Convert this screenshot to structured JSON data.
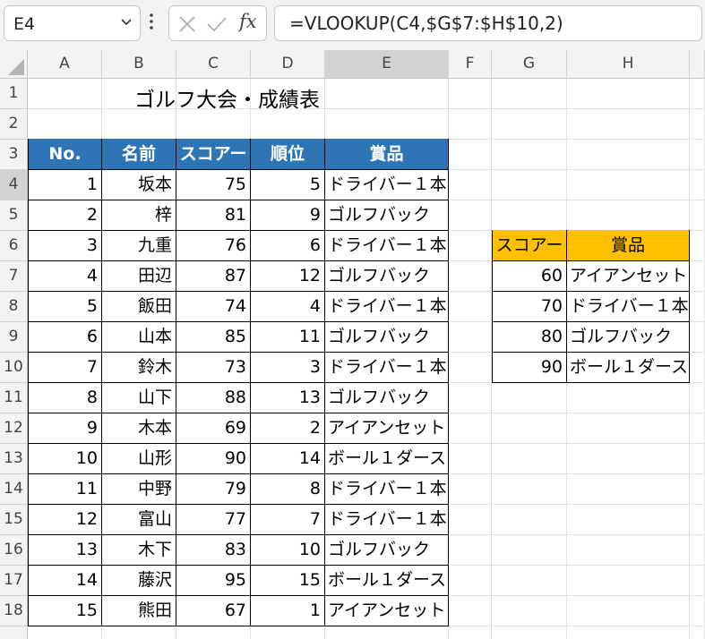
{
  "name_box": "E4",
  "formula_bar": {
    "fx_label": "fx",
    "formula": "=VLOOKUP(C4,$G$7:$H$10,2)"
  },
  "columns": [
    "A",
    "B",
    "C",
    "D",
    "E",
    "F",
    "G",
    "H"
  ],
  "rows": [
    "1",
    "2",
    "3",
    "4",
    "5",
    "6",
    "7",
    "8",
    "9",
    "10",
    "11",
    "12",
    "13",
    "14",
    "15",
    "16",
    "17",
    "18"
  ],
  "title": "ゴルフ大会・成績表",
  "main_table": {
    "headers": [
      "No.",
      "名前",
      "スコアー",
      "順位",
      "賞品"
    ],
    "rows": [
      [
        "1",
        "坂本",
        "75",
        "5",
        "ドライバー１本"
      ],
      [
        "2",
        "梓",
        "81",
        "9",
        "ゴルフバック"
      ],
      [
        "3",
        "九重",
        "76",
        "6",
        "ドライバー１本"
      ],
      [
        "4",
        "田辺",
        "87",
        "12",
        "ゴルフバック"
      ],
      [
        "5",
        "飯田",
        "74",
        "4",
        "ドライバー１本"
      ],
      [
        "6",
        "山本",
        "85",
        "11",
        "ゴルフバック"
      ],
      [
        "7",
        "鈴木",
        "73",
        "3",
        "ドライバー１本"
      ],
      [
        "8",
        "山下",
        "88",
        "13",
        "ゴルフバック"
      ],
      [
        "9",
        "木本",
        "69",
        "2",
        "アイアンセット"
      ],
      [
        "10",
        "山形",
        "90",
        "14",
        "ボール１ダース"
      ],
      [
        "11",
        "中野",
        "79",
        "8",
        "ドライバー１本"
      ],
      [
        "12",
        "富山",
        "77",
        "7",
        "ドライバー１本"
      ],
      [
        "13",
        "木下",
        "83",
        "10",
        "ゴルフバック"
      ],
      [
        "14",
        "藤沢",
        "95",
        "15",
        "ボール１ダース"
      ],
      [
        "15",
        "熊田",
        "67",
        "1",
        "アイアンセット"
      ]
    ]
  },
  "lookup_table": {
    "headers": [
      "スコアー",
      "賞品"
    ],
    "rows": [
      [
        "60",
        "アイアンセット"
      ],
      [
        "70",
        "ドライバー１本"
      ],
      [
        "80",
        "ゴルフバック"
      ],
      [
        "90",
        "ボール１ダース"
      ]
    ]
  },
  "colors": {
    "header_blue": "#2e75b6",
    "header_gold": "#ffc000",
    "selection_green": "#217346"
  },
  "icons": [
    "chevron-down-icon",
    "more-options-icon",
    "cancel-icon",
    "enter-icon",
    "select-all-icon"
  ]
}
